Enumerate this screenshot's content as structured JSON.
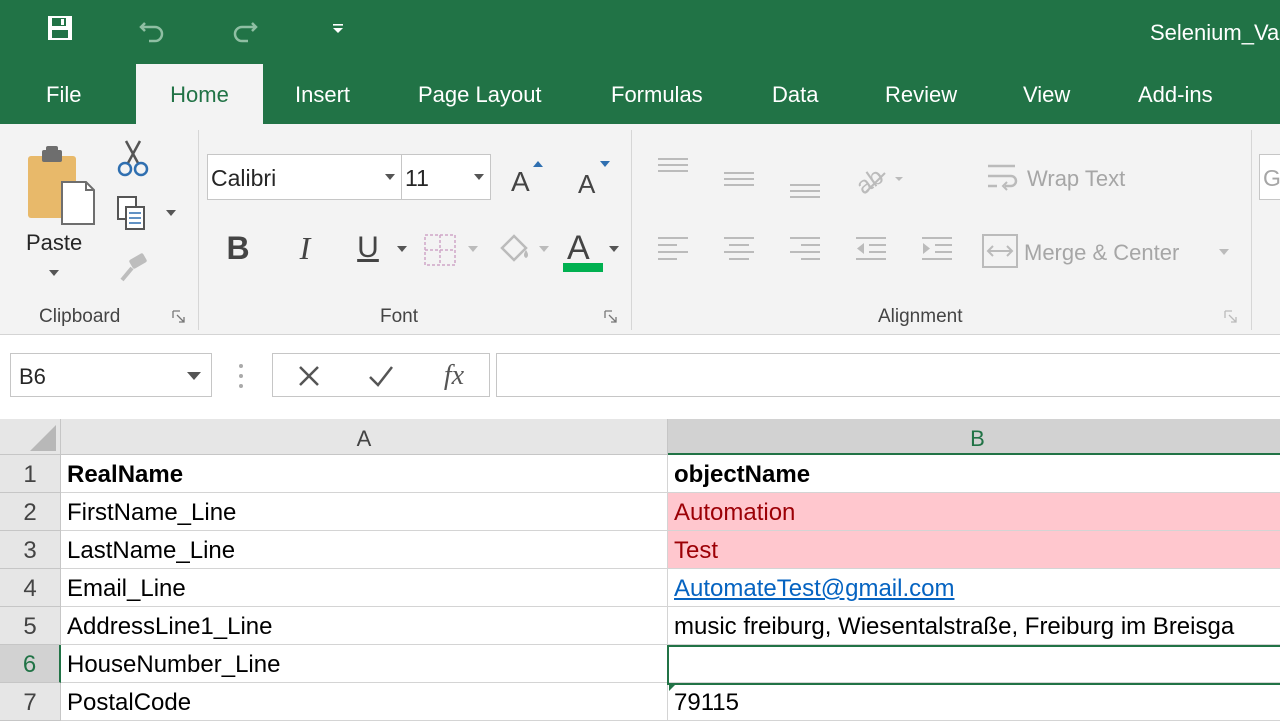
{
  "window": {
    "title": "Selenium_Va"
  },
  "quick_access": [
    {
      "name": "save",
      "icon": "save-icon"
    },
    {
      "name": "undo",
      "icon": "undo-icon"
    },
    {
      "name": "redo",
      "icon": "redo-icon"
    },
    {
      "name": "customize",
      "icon": "customize-quick-access-icon"
    }
  ],
  "tabs": [
    {
      "label": "File"
    },
    {
      "label": "Home",
      "active": true
    },
    {
      "label": "Insert"
    },
    {
      "label": "Page Layout"
    },
    {
      "label": "Formulas"
    },
    {
      "label": "Data"
    },
    {
      "label": "Review"
    },
    {
      "label": "View"
    },
    {
      "label": "Add-ins"
    }
  ],
  "ribbon": {
    "clipboard": {
      "label": "Clipboard",
      "paste": "Paste"
    },
    "font": {
      "label": "Font",
      "name": "Calibri",
      "size": "11"
    },
    "alignment": {
      "label": "Alignment",
      "wrap_text": "Wrap Text",
      "merge_center": "Merge & Center"
    },
    "number_partial": "G"
  },
  "formula_bar": {
    "name_box": "B6",
    "formula": ""
  },
  "columns": [
    "A",
    "B"
  ],
  "rows": [
    {
      "num": "1",
      "a": "RealName",
      "b": "objectName",
      "style": "bold"
    },
    {
      "num": "2",
      "a": "FirstName_Line",
      "b": "Automation",
      "style": "bad"
    },
    {
      "num": "3",
      "a": "LastName_Line",
      "b": "Test",
      "style": "bad"
    },
    {
      "num": "4",
      "a": "Email_Line",
      "b": "AutomateTest@gmail.com",
      "style": "link"
    },
    {
      "num": "5",
      "a": "AddressLine1_Line",
      "b": "music freiburg, Wiesentalstraße, Freiburg im Breisga",
      "style": ""
    },
    {
      "num": "6",
      "a": "HouseNumber_Line",
      "b": "",
      "style": ""
    },
    {
      "num": "7",
      "a": "PostalCode",
      "b": "79115",
      "style": ""
    }
  ],
  "selected": {
    "cell": "B6",
    "column": "B",
    "row": "6"
  },
  "colors": {
    "brand": "#217346",
    "bad_fill": "#ffc7ce",
    "bad_text": "#9c0006",
    "link": "#0563c1",
    "font_color_bar": "#00b050"
  }
}
